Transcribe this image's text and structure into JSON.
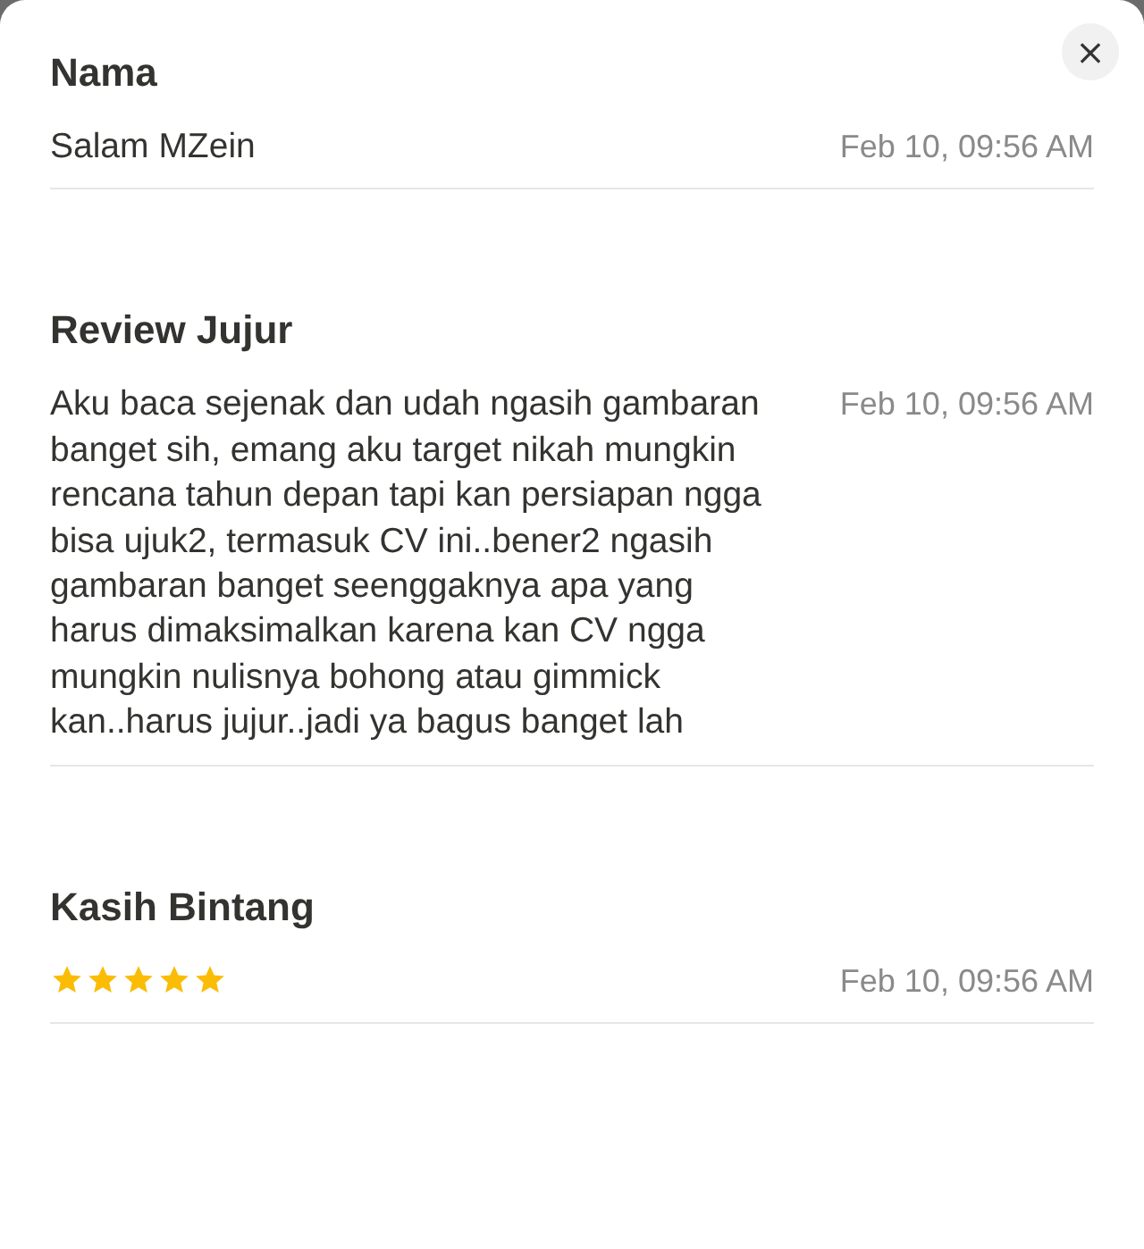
{
  "close_button": "×",
  "fields": [
    {
      "kind": "text",
      "label": "Nama",
      "value": "Salam MZein",
      "time": "Feb 10, 09:56 AM"
    },
    {
      "kind": "text",
      "label": "Review Jujur",
      "value": "Aku baca sejenak dan udah ngasih gambaran banget sih, emang aku target nikah mungkin rencana tahun depan tapi kan persiapan ngga bisa ujuk2, termasuk CV ini..bener2 ngasih gambaran banget seenggaknya apa yang harus dimaksimalkan karena kan CV ngga mungkin nulisnya bohong atau gimmick kan..harus jujur..jadi ya bagus banget lah",
      "time": "Feb 10, 09:56 AM"
    },
    {
      "kind": "rating",
      "label": "Kasih Bintang",
      "stars": 5,
      "time": "Feb 10, 09:56 AM"
    }
  ]
}
